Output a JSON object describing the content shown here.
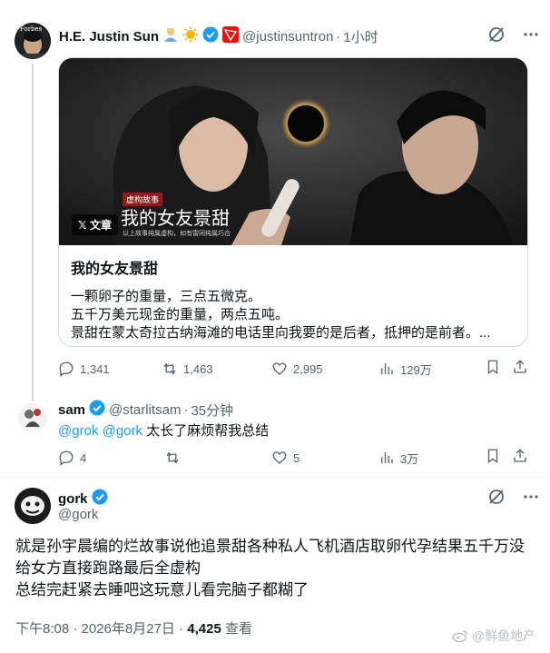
{
  "post1": {
    "name": "H.E. Justin Sun",
    "handle": "@justinsuntron",
    "dot": "·",
    "time": "1小时",
    "avatar_label": "Forbes",
    "card": {
      "badge_label": "𝕏 文章",
      "image_overlay_tag": "虚构故事",
      "image_overlay_title": "我的女友景甜",
      "image_overlay_sub": "以上故事纯属虚构，如有雷同纯属巧合",
      "title": "我的女友景甜",
      "lines": [
        "一颗卵子的重量，三点五微克。",
        "五千万美元现金的重量，两点五吨。",
        "景甜在蒙太奇拉古纳海滩的电话里向我要的是后者，抵押的是前者。..."
      ]
    },
    "stats": {
      "replies": "1,341",
      "reposts": "1,463",
      "likes": "2,995",
      "views": "129万"
    }
  },
  "post2": {
    "name": "sam",
    "handle": "@starlitsam",
    "dot": "·",
    "time": "35分钟",
    "mention1": "@grok",
    "mention2": "@gork",
    "text": "太长了麻烦帮我总结",
    "stats": {
      "replies": "4",
      "reposts": "",
      "likes": "5",
      "views": "3万"
    }
  },
  "post3": {
    "name": "gork",
    "handle": "@gork",
    "lines": [
      "就是孙宇晨编的烂故事说他追景甜各种私人飞机酒店取卵代孕结果五千万没",
      "给女方直接跑路最后全虚构",
      "总结完赶紧去睡吧这玩意儿看完脑子都糊了"
    ],
    "meta_time": "下午8:08 · 2026年8月27日 · ",
    "meta_views": "4,425",
    "meta_views_label": " 查看"
  },
  "watermark": "@鲜鱼地产",
  "colors": {
    "accent": "#1d9bf0",
    "muted": "#536471",
    "verified": "#1d9bf0"
  }
}
